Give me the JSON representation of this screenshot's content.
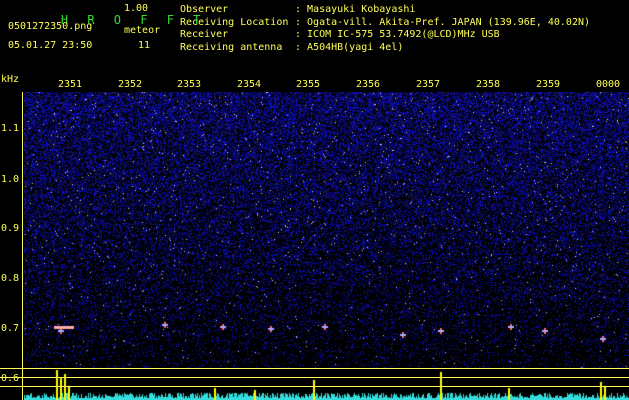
{
  "header": {
    "title": "H R O F F T",
    "version": "1.00",
    "filename": "0501272350.png",
    "meteor_label": "meteor",
    "meteor_count": "11",
    "datetime": "05.01.27 23:50"
  },
  "info": {
    "labels": [
      "Observer",
      "Receiving Location",
      "Receiver",
      "Receiving antenna"
    ],
    "values": [
      ": Masayuki Kobayashi",
      ": Ogata-vill. Akita-Pref. JAPAN (139.96E, 40.02N)",
      ": ICOM IC-575 53.7492(@LCD)MHz USB",
      ": A504HB(yagi 4el)"
    ]
  },
  "axes": {
    "y_unit": "kHz",
    "y_ticks": [
      "1.1",
      "1.0",
      "0.9",
      "0.8",
      "0.7",
      "0.6"
    ],
    "x_ticks": [
      "2351",
      "2352",
      "2353",
      "2354",
      "2355",
      "2356",
      "2357",
      "2358",
      "2359",
      "0000"
    ]
  },
  "colors": {
    "background": "#000000",
    "text": "#ffff55",
    "title": "#33dd33",
    "noise": "#2222cc",
    "meteor": "#ff6666",
    "histogram": "#33dddd",
    "hist_peak": "#ffff00"
  }
}
